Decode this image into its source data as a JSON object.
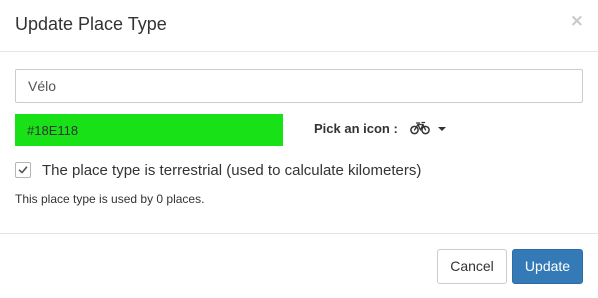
{
  "dialog": {
    "title": "Update Place Type",
    "close_glyph": "×"
  },
  "form": {
    "name_value": "Vélo",
    "color_value": "#18E118",
    "color_swatch": "#18E118",
    "icon_label": "Pick an icon :",
    "selected_icon": "bicycle-icon",
    "terrestrial_checked": true,
    "terrestrial_label": "The place type is terrestrial (used to calculate kilometers)",
    "usage_text": "This place type is used by 0 places."
  },
  "footer": {
    "cancel_label": "Cancel",
    "update_label": "Update",
    "primary_color": "#337ab7"
  }
}
